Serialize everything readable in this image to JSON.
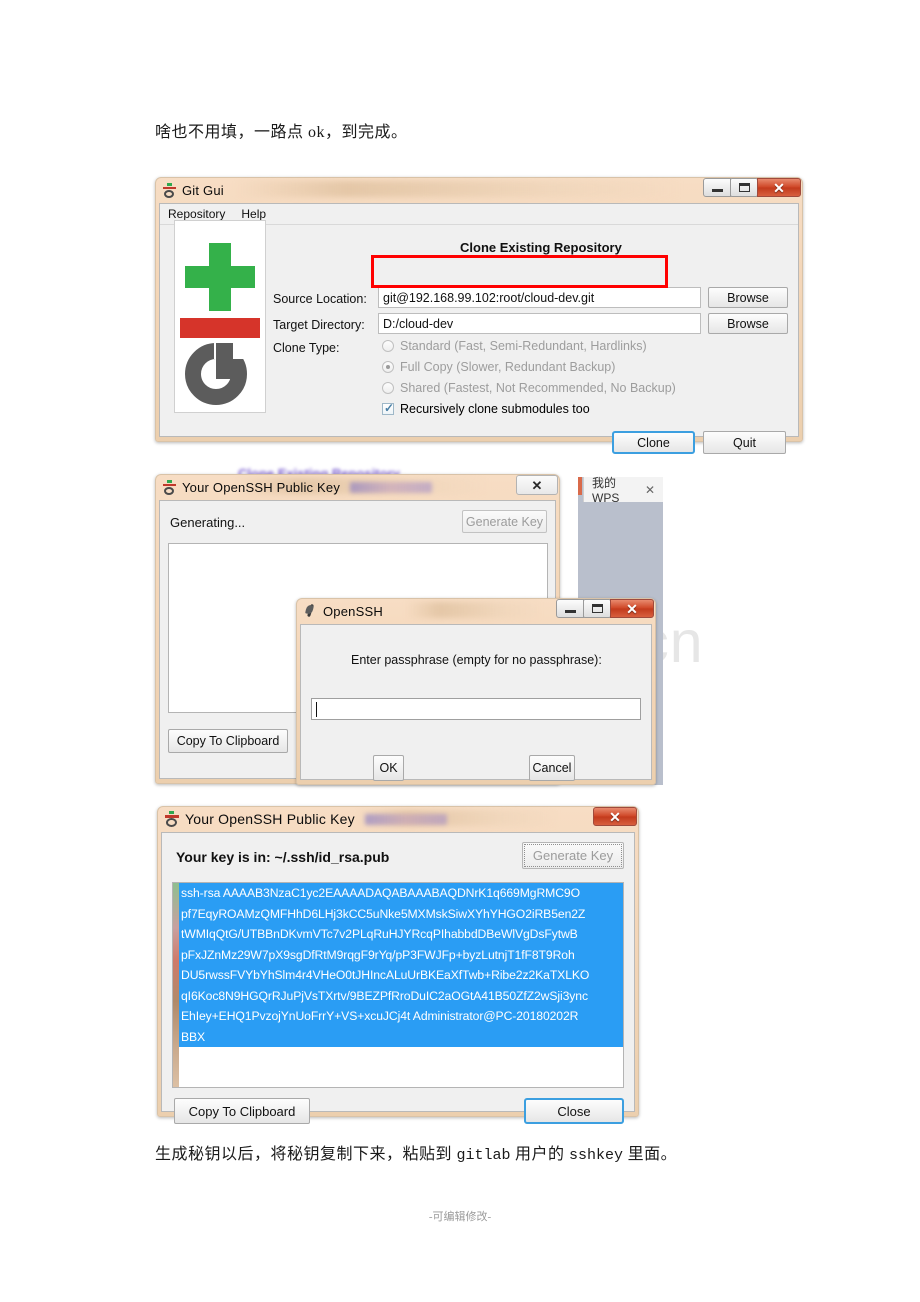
{
  "document": {
    "paragraph_top": "啥也不用填，一路点 ok，到完成。",
    "paragraph_bottom_part1": "生成秘钥以后，将秘钥复制下来，粘贴到 ",
    "paragraph_bottom_mono": "gitlab",
    "paragraph_bottom_part2": " 用户的 ",
    "paragraph_bottom_mono2": "sshkey",
    "paragraph_bottom_part3": " 里面。",
    "footer_note": "-可编辑修改-",
    "watermark": "www.zixin.com.cn"
  },
  "git_gui_window": {
    "title": "Git Gui",
    "icon": "git-gui-icon",
    "menu": [
      "Repository",
      "Help"
    ],
    "section_title": "Clone Existing Repository",
    "fields": [
      {
        "label": "Source Location:",
        "value": "git@192.168.99.102:root/cloud-dev.git",
        "browse_label": "Browse"
      },
      {
        "label": "Target Directory:",
        "value": "D:/cloud-dev",
        "browse_label": "Browse"
      }
    ],
    "clone_type_label": "Clone Type:",
    "clone_types": [
      {
        "label": "Standard (Fast, Semi-Redundant, Hardlinks)",
        "selected": false,
        "disabled": true
      },
      {
        "label": "Full Copy (Slower, Redundant Backup)",
        "selected": true,
        "disabled": true
      },
      {
        "label": "Shared (Fastest, Not Recommended, No Backup)",
        "selected": false,
        "disabled": true
      }
    ],
    "checkbox": {
      "label": "Recursively clone submodules too",
      "checked": true
    },
    "buttons": {
      "primary": "Clone",
      "secondary": "Quit"
    },
    "caption": {
      "minimize": "minimize-icon",
      "maximize": "maximize-icon",
      "close": "close-icon"
    },
    "highlight_color": "#ff0000"
  },
  "generating_window": {
    "title": "Your OpenSSH Public Key",
    "icon": "git-gui-icon",
    "status_text": "Generating...",
    "generate_button": "Generate Key",
    "copy_button": "Copy To Clipboard",
    "close_caption": "close-icon",
    "background_text": "Clone Existing Repository"
  },
  "openssh_window": {
    "title": "OpenSSH",
    "icon": "feather-icon",
    "prompt": "Enter passphrase (empty for no passphrase):",
    "input_value": "",
    "ok_label": "OK",
    "cancel_label": "Cancel",
    "caption": {
      "minimize": "minimize-icon",
      "maximize": "maximize-icon",
      "close": "close-icon"
    }
  },
  "wps": {
    "tab_label": "我的WPS",
    "close_icon": "close-icon"
  },
  "pubkey_window": {
    "title": "Your OpenSSH Public Key",
    "icon": "git-gui-icon",
    "status_text": "Your key is in: ~/.ssh/id_rsa.pub",
    "generate_button": "Generate Key",
    "key_lines": [
      "ssh-rsa AAAAB3NzaC1yc2EAAAADAQABAAABAQDNrK1q669MgRMC9O",
      "pf7EqyROAMzQMFHhD6LHj3kCC5uNke5MXMskSiwXYhYHGO2iRB5en2Z",
      "tWMIqQtG/UTBBnDKvmVTc7v2PLqRuHJYRcqPIhabbdDBeWlVgDsFytwB",
      "pFxJZnMz29W7pX9sgDfRtM9rqgF9rYq/pP3FWJFp+byzLutnjT1fF8T9Roh",
      "DU5rwssFVYbYhSlm4r4VHeO0tJHIncALuUrBKEaXfTwb+Ribe2z2KaTXLKO",
      "qI6Koc8N9HGQrRJuPjVsTXrtv/9BEZPfRroDuIC2aOGtA41B50ZfZ2wSji3ync",
      "EhIey+EHQ1PvzojYnUoFrrY+VS+xcuJCj4t Administrator@PC-20180202R",
      "BBX"
    ],
    "copy_button": "Copy To Clipboard",
    "close_button": "Close",
    "close_caption": "close-icon",
    "selection_color": "#2a9df4"
  }
}
